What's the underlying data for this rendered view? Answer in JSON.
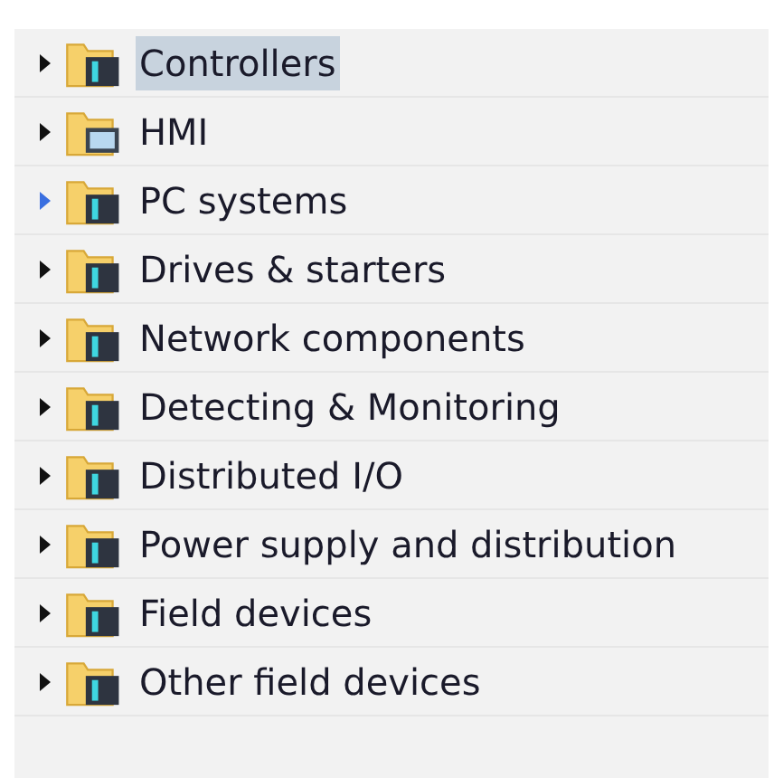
{
  "tree": {
    "items": [
      {
        "label": "Controllers",
        "kind": "device",
        "selected": true,
        "hovered": false
      },
      {
        "label": "HMI",
        "kind": "hmi",
        "selected": false,
        "hovered": false
      },
      {
        "label": "PC systems",
        "kind": "device",
        "selected": false,
        "hovered": true
      },
      {
        "label": "Drives & starters",
        "kind": "device",
        "selected": false,
        "hovered": false
      },
      {
        "label": "Network components",
        "kind": "device",
        "selected": false,
        "hovered": false
      },
      {
        "label": "Detecting & Monitoring",
        "kind": "device",
        "selected": false,
        "hovered": false
      },
      {
        "label": "Distributed I/O",
        "kind": "device",
        "selected": false,
        "hovered": false
      },
      {
        "label": "Power supply and distribution",
        "kind": "device",
        "selected": false,
        "hovered": false
      },
      {
        "label": "Field devices",
        "kind": "device",
        "selected": false,
        "hovered": false
      },
      {
        "label": "Other field devices",
        "kind": "device",
        "selected": false,
        "hovered": false
      }
    ]
  }
}
